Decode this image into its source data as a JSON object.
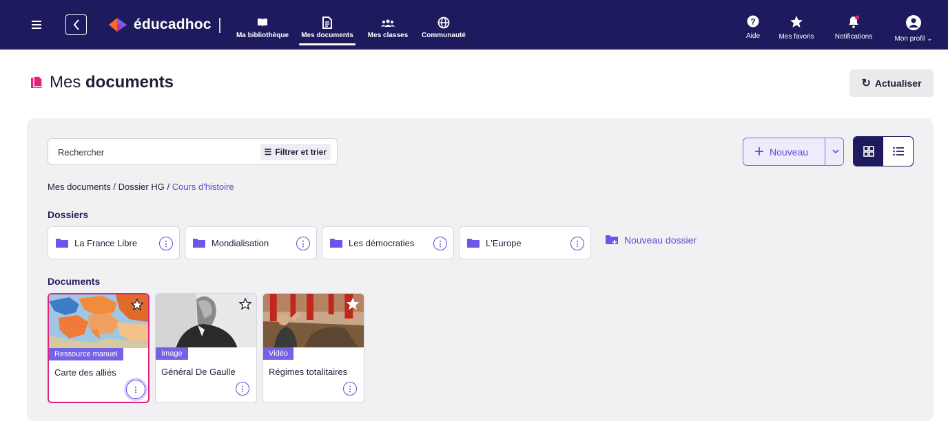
{
  "nav": {
    "brand": "éducadhoc",
    "items": [
      {
        "label": "Ma bibliothèque"
      },
      {
        "label": "Mes documents"
      },
      {
        "label": "Mes classes"
      },
      {
        "label": "Communauté"
      }
    ],
    "right": [
      {
        "label": "Aide"
      },
      {
        "label": "Mes favoris"
      },
      {
        "label": "Notifications"
      },
      {
        "label": "Mon profil"
      }
    ]
  },
  "header": {
    "title_prefix": "Mes",
    "title_bold": "documents",
    "refresh_label": "Actualiser"
  },
  "toolbar": {
    "search_placeholder": "Rechercher",
    "filter_label": "Filtrer et trier",
    "new_label": "Nouveau"
  },
  "breadcrumb": {
    "items": [
      "Mes documents",
      "Dossier HG"
    ],
    "current": "Cours d'histoire",
    "separator": "/"
  },
  "folders": {
    "heading": "Dossiers",
    "items": [
      {
        "name": "La France Libre"
      },
      {
        "name": "Mondialisation"
      },
      {
        "name": "Les démocraties"
      },
      {
        "name": "L'Europe"
      }
    ],
    "new_folder_label": "Nouveau dossier"
  },
  "documents": {
    "heading": "Documents",
    "items": [
      {
        "title": "Carte des alliés",
        "type": "Ressource manuel",
        "favorite": false
      },
      {
        "title": "Général De Gaulle",
        "type": "Image",
        "favorite": false
      },
      {
        "title": "Régimes totalitaires",
        "type": "Vidéo",
        "favorite": true
      }
    ]
  },
  "colors": {
    "nav_bg": "#1d1b5e",
    "accent": "#5b4bd6",
    "tag": "#7361e6",
    "selected": "#e0247d",
    "title_icon": "#e0247d"
  }
}
